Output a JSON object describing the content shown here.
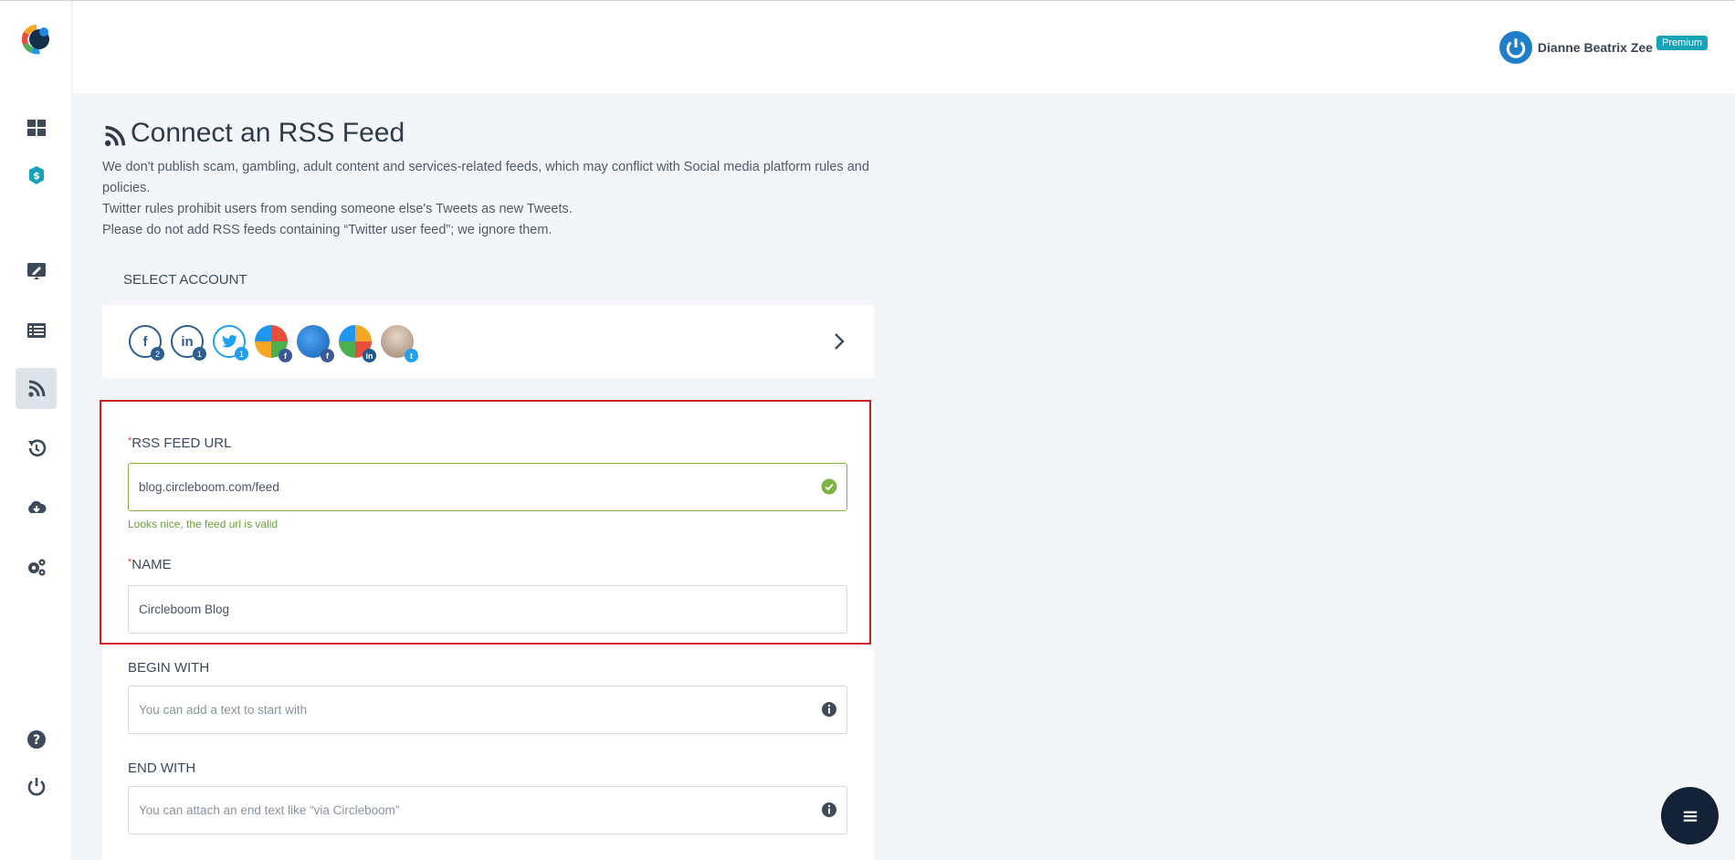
{
  "header": {
    "user_name": "Dianne Beatrix Zee",
    "badge": "Premium"
  },
  "sidebar": {
    "items": [
      {
        "name": "dashboard",
        "icon": "grid-icon"
      },
      {
        "name": "pricing",
        "icon": "dollar-icon"
      },
      {
        "name": "create-post",
        "icon": "edit-icon"
      },
      {
        "name": "queue",
        "icon": "list-icon"
      },
      {
        "name": "rss",
        "icon": "rss-icon",
        "active": true
      },
      {
        "name": "history",
        "icon": "history-icon"
      },
      {
        "name": "download",
        "icon": "cloud-download-icon"
      },
      {
        "name": "settings",
        "icon": "gears-icon"
      },
      {
        "name": "help",
        "icon": "question-icon"
      },
      {
        "name": "logout",
        "icon": "power-icon"
      }
    ]
  },
  "page": {
    "title": "Connect an RSS Feed",
    "description": [
      "We don't publish scam, gambling, adult content and services-related feeds, which may conflict with Social media platform rules and policies.",
      "Twitter rules prohibit users from sending someone else's Tweets as new Tweets.",
      "Please do not add RSS feeds containing “Twitter user feed”; we ignore them."
    ]
  },
  "select_account": {
    "label": "SELECT ACCOUNT",
    "accounts": [
      {
        "type": "facebook",
        "letter": "f",
        "count": "2"
      },
      {
        "type": "linkedin",
        "letter": "in",
        "count": "1"
      },
      {
        "type": "twitter",
        "letter": "t",
        "count": "1"
      },
      {
        "type": "facebook-page",
        "network": "f"
      },
      {
        "type": "facebook-page",
        "network": "f"
      },
      {
        "type": "linkedin-page",
        "network": "in"
      },
      {
        "type": "twitter-user",
        "network": "t"
      }
    ]
  },
  "form": {
    "rss_url": {
      "required": "*",
      "label": "RSS FEED URL",
      "value": "blog.circleboom.com/feed",
      "hint": "Looks nice, the feed url is valid"
    },
    "name": {
      "required": "*",
      "label": "NAME",
      "value": "Circleboom Blog"
    },
    "begin_with": {
      "label": "BEGIN WITH",
      "placeholder": "You can add a text to start with"
    },
    "end_with": {
      "label": "END WITH",
      "placeholder": "You can attach an end text like “via Circleboom”"
    }
  },
  "colors": {
    "accent": "#17a2b8",
    "valid": "#7cb342",
    "highlight": "#cc1f26",
    "fab": "#132236"
  }
}
